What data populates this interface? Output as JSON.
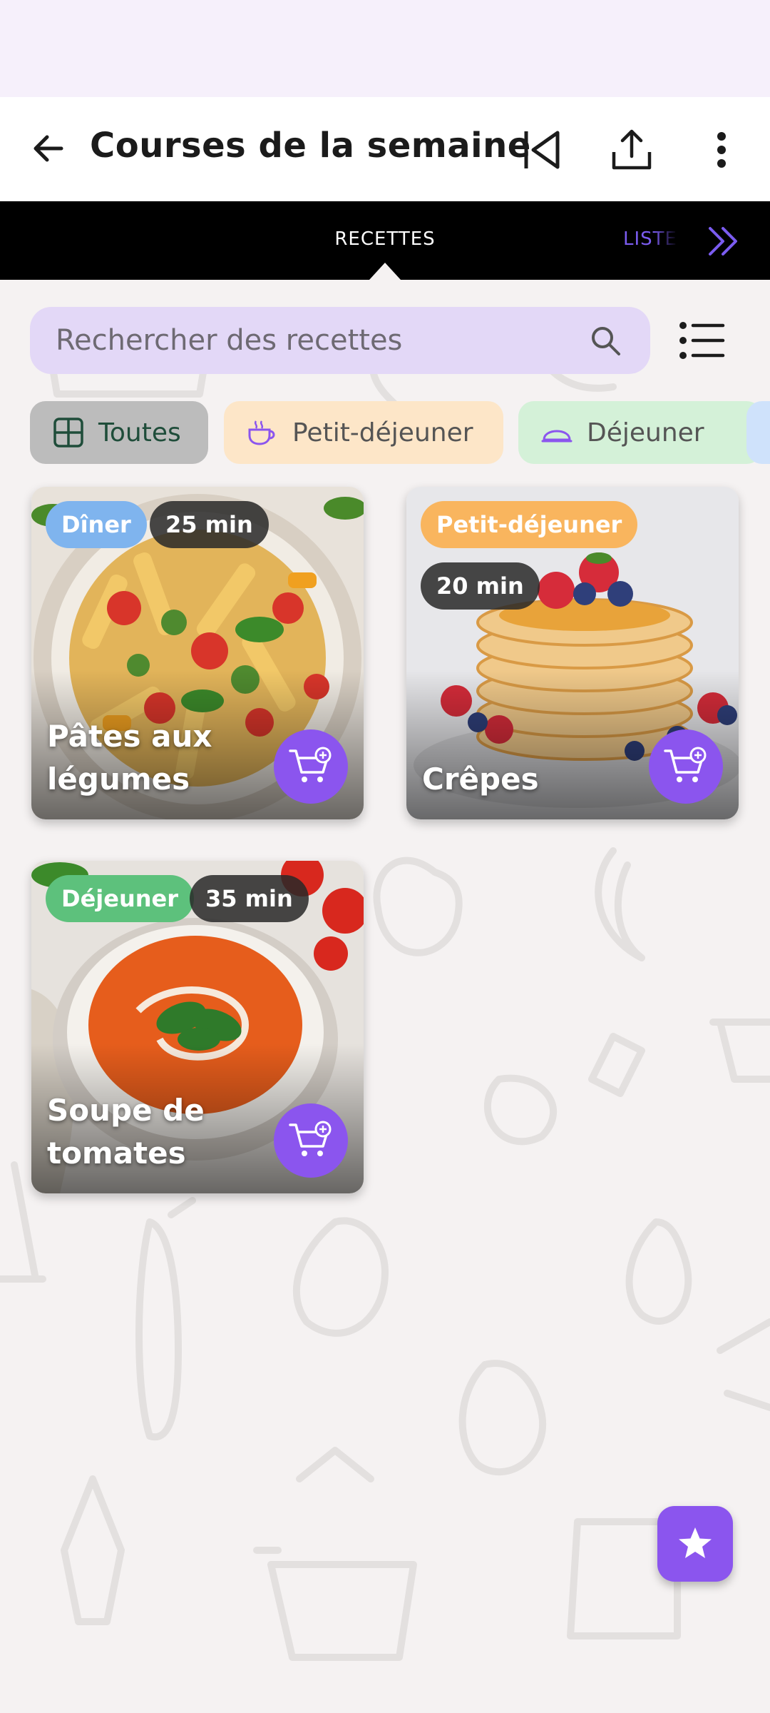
{
  "header": {
    "title": "Courses de la semaine",
    "icons": [
      "back-arrow-icon",
      "skip-previous-icon",
      "share-icon",
      "more-vert-icon"
    ]
  },
  "tabs": {
    "recettes": "RECETTES",
    "liste": "LISTE"
  },
  "search": {
    "placeholder": "Rechercher des recettes"
  },
  "filters": [
    {
      "label": "Toutes",
      "icon": "grid-icon",
      "selected": true
    },
    {
      "label": "Petit-déjeuner",
      "icon": "coffee-cup-icon"
    },
    {
      "label": "Déjeuner",
      "icon": "cloche-icon"
    },
    {
      "label": "",
      "icon": ""
    }
  ],
  "recipes": [
    {
      "title": "Pâtes aux légumes",
      "category": "Dîner",
      "time": "25 min",
      "category_color": "#7fb4ee"
    },
    {
      "title": "Crêpes",
      "category": "Petit-déjeuner",
      "time": "20 min",
      "category_color": "#f9b55e"
    },
    {
      "title": "Soupe de tomates",
      "category": "Déjeuner",
      "time": "35 min",
      "category_color": "#5dc17c"
    }
  ],
  "colors": {
    "accent": "#8b55ee",
    "tab_bar": "#000000",
    "search_bg": "#e3d8f7"
  }
}
